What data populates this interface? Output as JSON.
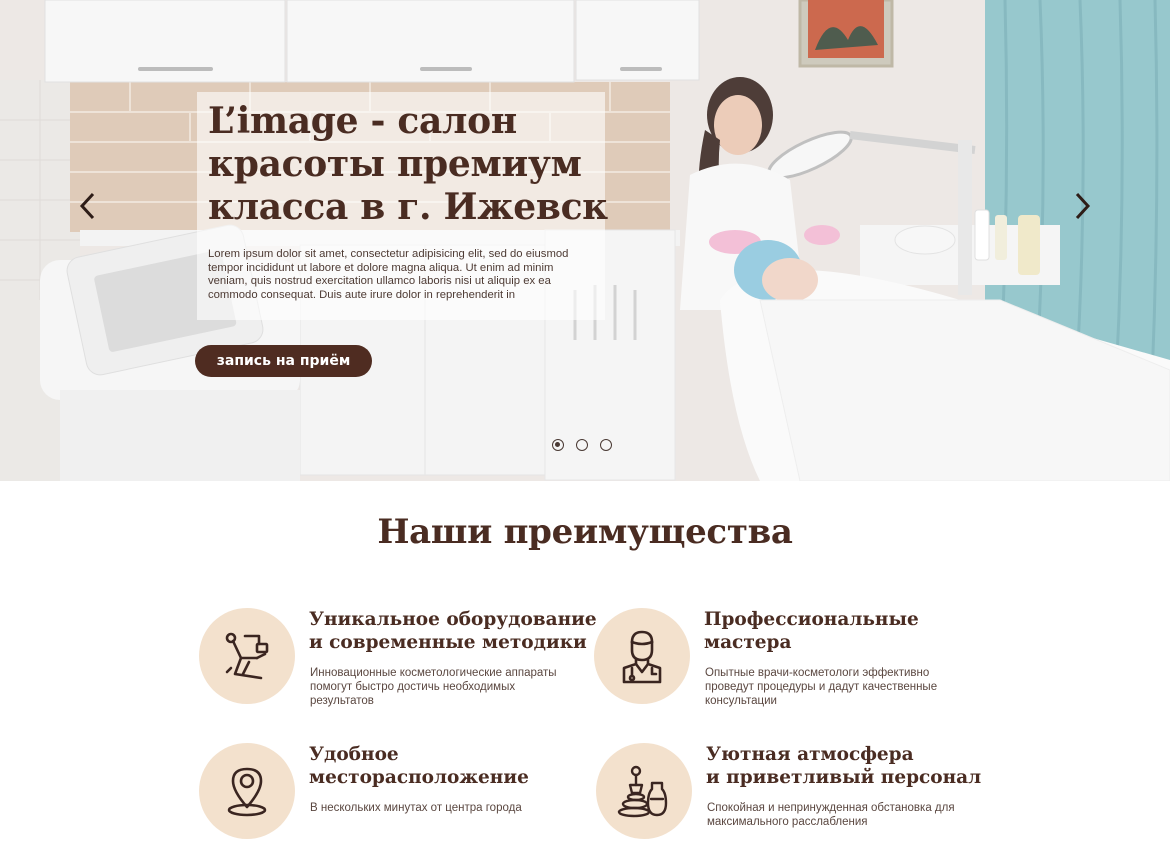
{
  "hero": {
    "title": "L’image - салон красоты премиум класса в г. Ижевск",
    "text": "Lorem ipsum dolor sit amet, consectetur adipisicing elit, sed do eiusmod tempor incididunt ut labore et dolore magna aliqua. Ut enim ad minim veniam, quis nostrud exercitation ullamco laboris nisi ut aliquip ex ea commodo consequat. Duis aute irure dolor in reprehenderit in",
    "cta_label": "запись на приём",
    "prev_icon": "chevron-left-icon",
    "next_icon": "chevron-right-icon",
    "slides_count": 3,
    "active_slide": 1
  },
  "advantages": {
    "title": "Наши преимущества",
    "items": [
      {
        "icon": "dental-chair-icon",
        "title_line1": "Уникальное оборудование",
        "title_line2": "и современные методики",
        "text": "Инновационные косметологические аппараты помогут быстро достичь необходимых результатов"
      },
      {
        "icon": "doctor-icon",
        "title_line1": "Профессиональные",
        "title_line2": "мастера",
        "text": "Опытные врачи-косметологи эффективно проведут процедуры и дадут качественные консультации"
      },
      {
        "icon": "location-pin-icon",
        "title_line1": "Удобное",
        "title_line2": "месторасположение",
        "text": "В нескольких минутах от центра города"
      },
      {
        "icon": "spa-stones-icon",
        "title_line1": "Уютная атмосфера",
        "title_line2": "и приветливый персонал",
        "text": "Спокойная и непринужденная обстановка для максимального расслабления"
      }
    ]
  },
  "colors": {
    "brand_brown": "#4f2c21",
    "icon_circle": "#f3e1cd",
    "curtain_teal": "#8cc2c8"
  }
}
